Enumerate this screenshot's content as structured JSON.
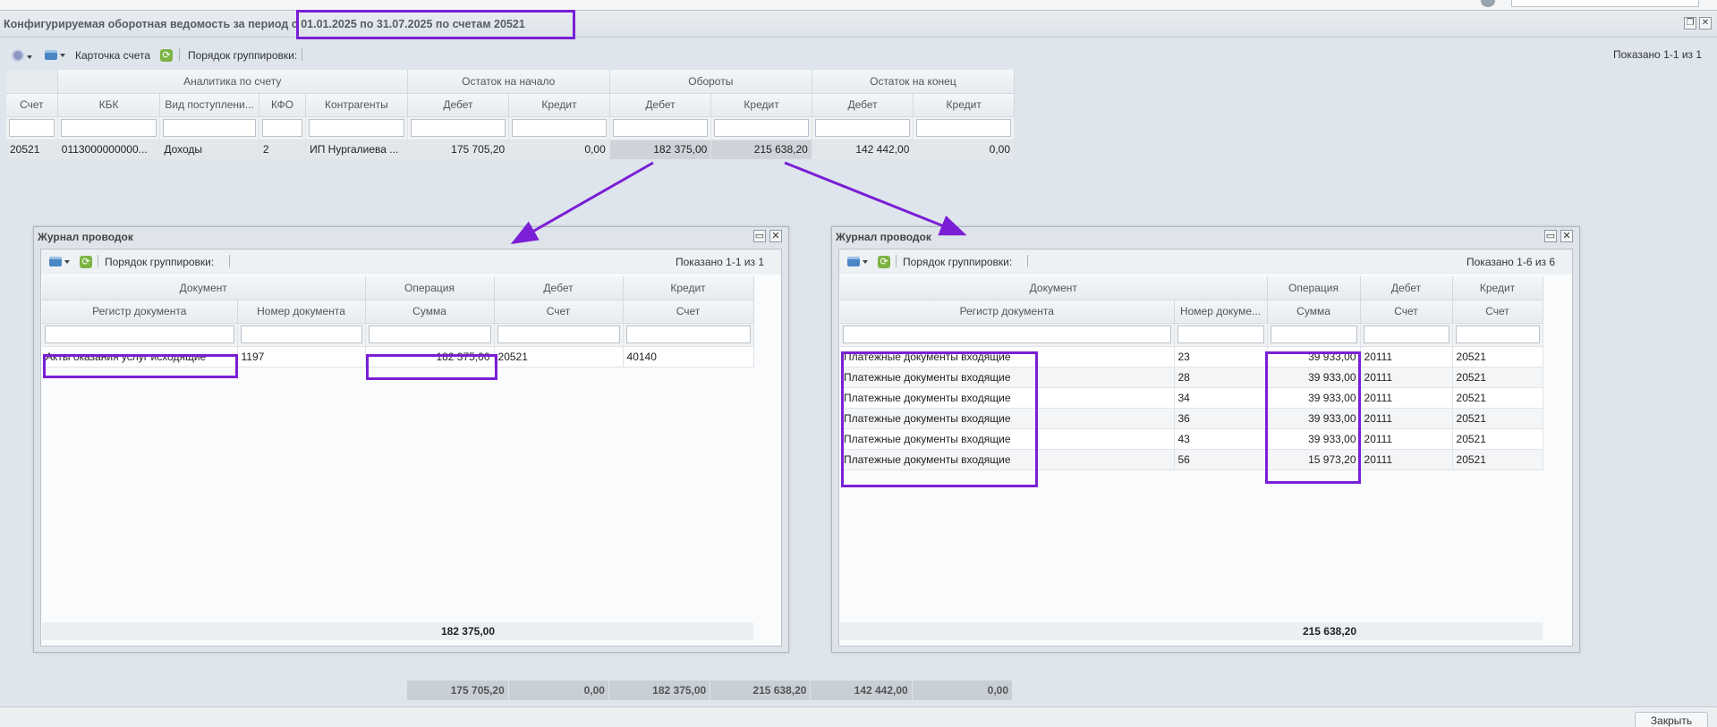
{
  "main": {
    "title_prefix": "Конфигурируемая оборотная ведомость за период ",
    "title_highlight": "с 01.01.2025 по 31.07.2025 по счетам 20521",
    "toolbar": {
      "card_label": "Карточка счета",
      "grouping_label": "Порядок группировки:"
    },
    "shown": "Показано 1-1 из 1",
    "groups": [
      "Аналитика по счету",
      "Остаток на начало",
      "Обороты",
      "Остаток на конец"
    ],
    "columns": [
      "Счет",
      "КБК",
      "Вид поступлени...",
      "КФО",
      "Контрагенты",
      "Дебет",
      "Кредит",
      "Дебет",
      "Кредит",
      "Дебет",
      "Кредит"
    ],
    "row": [
      "20521",
      "0113000000000...",
      "Доходы",
      "2",
      "ИП Нургалиева ...",
      "175 705,20",
      "0,00",
      "182 375,00",
      "215 638,20",
      "142 442,00",
      "0,00"
    ],
    "totals": [
      "175 705,20",
      "0,00",
      "182 375,00",
      "215 638,20",
      "142 442,00",
      "0,00"
    ]
  },
  "journal_left": {
    "title": "Журнал проводок",
    "grouping_label": "Порядок группировки:",
    "shown": "Показано 1-1 из 1",
    "groups": [
      "Документ",
      "Операция",
      "Дебет",
      "Кредит"
    ],
    "columns": [
      "Регистр документа",
      "Номер документа",
      "Сумма",
      "Счет",
      "Счет"
    ],
    "rows": [
      [
        "Акты оказания услуг исходящие",
        "1197",
        "182 375,00",
        "20521",
        "40140"
      ]
    ],
    "total": "182 375,00"
  },
  "journal_right": {
    "title": "Журнал проводок",
    "grouping_label": "Порядок группировки:",
    "shown": "Показано 1-6 из 6",
    "groups": [
      "Документ",
      "Операция",
      "Дебет",
      "Кредит"
    ],
    "columns": [
      "Регистр документа",
      "Номер докуме...",
      "Сумма",
      "Счет",
      "Счет"
    ],
    "rows": [
      [
        "Платежные документы входящие",
        "23",
        "39 933,00",
        "20111",
        "20521"
      ],
      [
        "Платежные документы входящие",
        "28",
        "39 933,00",
        "20111",
        "20521"
      ],
      [
        "Платежные документы входящие",
        "34",
        "39 933,00",
        "20111",
        "20521"
      ],
      [
        "Платежные документы входящие",
        "36",
        "39 933,00",
        "20111",
        "20521"
      ],
      [
        "Платежные документы входящие",
        "43",
        "39 933,00",
        "20111",
        "20521"
      ],
      [
        "Платежные документы входящие",
        "56",
        "15 973,20",
        "20111",
        "20521"
      ]
    ],
    "total": "215 638,20"
  },
  "footer": {
    "close_label": "Закрыть"
  },
  "colors": {
    "highlight": "#7a1fd6",
    "refresh": "#7cb342",
    "print": "#4a86c5"
  },
  "icons": [
    "gear-icon",
    "print-icon",
    "refresh-icon",
    "restore-icon",
    "close-icon",
    "maximize-icon"
  ]
}
